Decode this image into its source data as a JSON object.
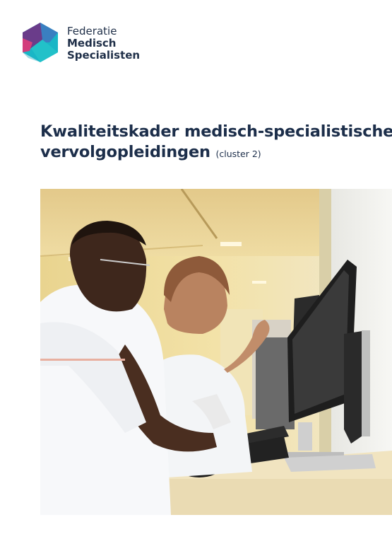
{
  "logo": {
    "line1": "Federatie",
    "line2": "Medisch",
    "line3": "Specialisten",
    "colors": {
      "teal": "#19b6c6",
      "purple": "#5a3b7e",
      "pink": "#d6387a",
      "navy": "#1f2f48"
    }
  },
  "document": {
    "title_line1": "Kwaliteitskader medisch-specialistische",
    "title_line2": "vervolgopleidingen",
    "title_suffix": "(cluster 2)",
    "title_color": "#1c2e4a"
  },
  "photo": {
    "subject": "two-doctors-at-computer"
  }
}
